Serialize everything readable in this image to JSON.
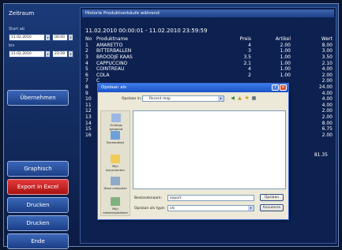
{
  "left_panel": {
    "zeitraum_label": "Zeitraum",
    "start_label": "Start ab",
    "start_date": "11.02.2010",
    "start_time": "00:00",
    "end_label": "bis",
    "end_date": "11.02.2010",
    "end_time": "23:59",
    "apply_button": "Übernehmen",
    "buttons": [
      "Graphisch",
      "Export in Excel",
      "Drucken",
      "Drucken",
      "Ende"
    ]
  },
  "right_panel": {
    "header": "Historie Produktverkäufe während",
    "range": "11.02.2010 00:00:01 - 11.02.2010 23:59:59",
    "columns": [
      "No",
      "Produktname",
      "Preis",
      "Artikel",
      "Wert"
    ],
    "rows": [
      [
        "1",
        "AMARETTO",
        "4",
        "2.00",
        "8.00"
      ],
      [
        "2",
        "BITTERBALLEN",
        "3",
        "1.00",
        "3.00"
      ],
      [
        "3",
        "BROODJE KAAS",
        "3.5",
        "1.00",
        "3.50"
      ],
      [
        "4",
        "CAPPUCCINO",
        "2.1",
        "1.00",
        "2.10"
      ],
      [
        "5",
        "COINTREAU",
        "4",
        "1.00",
        "4.00"
      ],
      [
        "6",
        "COLA",
        "2",
        "1.00",
        "2.00"
      ],
      [
        "7",
        "C",
        "",
        "",
        "2.00"
      ],
      [
        "8",
        "",
        "",
        "",
        "24.00"
      ],
      [
        "9",
        "",
        "",
        "",
        "4.00"
      ],
      [
        "10",
        "",
        "",
        "",
        "4.00"
      ],
      [
        "11",
        "",
        "",
        "",
        "4.00"
      ],
      [
        "12",
        "",
        "",
        "",
        "2.00"
      ],
      [
        "13",
        "",
        "",
        "",
        "2.00"
      ],
      [
        "14",
        "",
        "",
        "",
        "8.00"
      ],
      [
        "15",
        "",
        "",
        "",
        "6.75"
      ],
      [
        "16",
        "",
        "",
        "",
        "2.00"
      ]
    ],
    "total": "81.35"
  },
  "dialog": {
    "title": "Opslaan als",
    "save_in_label": "Opslaan in:",
    "save_in_value": "Recent map",
    "places": [
      "Onlangs geopend",
      "Bureaublad",
      "Mijn documenten",
      "Deze computer",
      "Mijn netwerkplaatsen"
    ],
    "filename_label": "Bestandsnaam:",
    "filename_value": "export",
    "filetype_label": "Opslaan als type:",
    "filetype_value": "xls",
    "save_button": "Opslaan",
    "cancel_button": "Annuleren"
  }
}
